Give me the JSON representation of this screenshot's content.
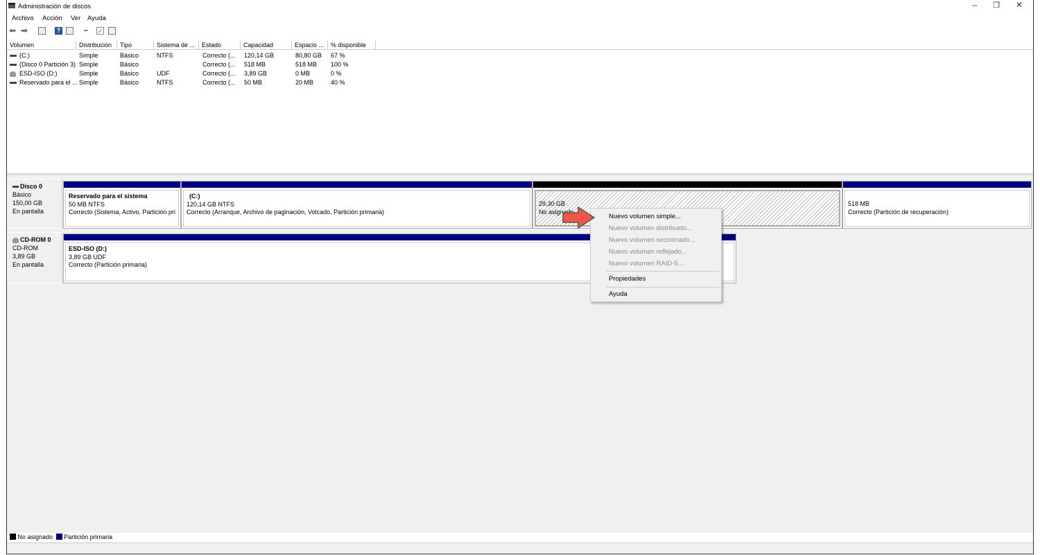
{
  "window": {
    "title": "Administración de discos"
  },
  "menu": [
    "Archivo",
    "Acción",
    "Ver",
    "Ayuda"
  ],
  "toolbar": [
    "back-icon",
    "forward-icon",
    "console-tree-icon",
    "help-icon",
    "show-pane-icon",
    "connect-icon",
    "checklist-icon",
    "properties-icon"
  ],
  "volumes": {
    "columns": [
      "Volumen",
      "Distribución",
      "Tipo",
      "Sistema de ...",
      "Estado",
      "Capacidad",
      "Espacio ...",
      "% disponible"
    ],
    "rows": [
      [
        "(C:)",
        "Simple",
        "Básico",
        "NTFS",
        "Correcto (...",
        "120,14 GB",
        "80,80 GB",
        "67 %"
      ],
      [
        "(Disco 0 Partición 3)",
        "Simple",
        "Básico",
        "",
        "Correcto (...",
        "518 MB",
        "518 MB",
        "100 %"
      ],
      [
        "ESD-ISO (D:)",
        "Simple",
        "Básico",
        "UDF",
        "Correcto (...",
        "3,89 GB",
        "0 MB",
        "0 %"
      ],
      [
        "Reservado para el ...",
        "Simple",
        "Básico",
        "NTFS",
        "Correcto (...",
        "50 MB",
        "20 MB",
        "40 %"
      ]
    ]
  },
  "disks": [
    {
      "name": "Disco 0",
      "type": "Básico",
      "size": "150,00 GB",
      "status": "En pantalla",
      "partitions": [
        {
          "name": "Reservado para el sistema",
          "info": "50 MB NTFS",
          "status": "Correcto (Sistema, Activo, Partición pri"
        },
        {
          "name": "(C:)",
          "info": "120,14 GB NTFS",
          "status": "Correcto (Arranque, Archivo de paginación, Volcado, Partición primaria)"
        },
        {
          "name": "",
          "info": "29,30 GB",
          "status": "No asignado"
        },
        {
          "name": "",
          "info": "518 MB",
          "status": "Correcto (Partición de recuperación)"
        }
      ]
    },
    {
      "name": "CD-ROM 0",
      "type": "CD-ROM",
      "size": "3,89 GB",
      "status": "En pantalla",
      "partitions": [
        {
          "name": "ESD-ISO  (D:)",
          "info": "3,89 GB UDF",
          "status": "Correcto (Partición primaria)"
        }
      ]
    }
  ],
  "context_menu": {
    "items": [
      {
        "label": "Nuevo volumen simple...",
        "enabled": true
      },
      {
        "label": "Nuevo volumen distribuido...",
        "enabled": false
      },
      {
        "label": "Nuevo volumen seccionado...",
        "enabled": false
      },
      {
        "label": "Nuevo volumen reflejado...",
        "enabled": false
      },
      {
        "label": "Nuevo volumen RAID-5...",
        "enabled": false
      },
      {
        "label": "Propiedades",
        "enabled": true
      },
      {
        "label": "Ayuda",
        "enabled": true
      }
    ]
  },
  "legend": [
    {
      "label": "No asignado",
      "color": "#000000"
    },
    {
      "label": "Partición primaria",
      "color": "#000080"
    }
  ],
  "colors": {
    "primary": "#000080",
    "unallocated": "#000000",
    "arrow": "#f05545"
  }
}
